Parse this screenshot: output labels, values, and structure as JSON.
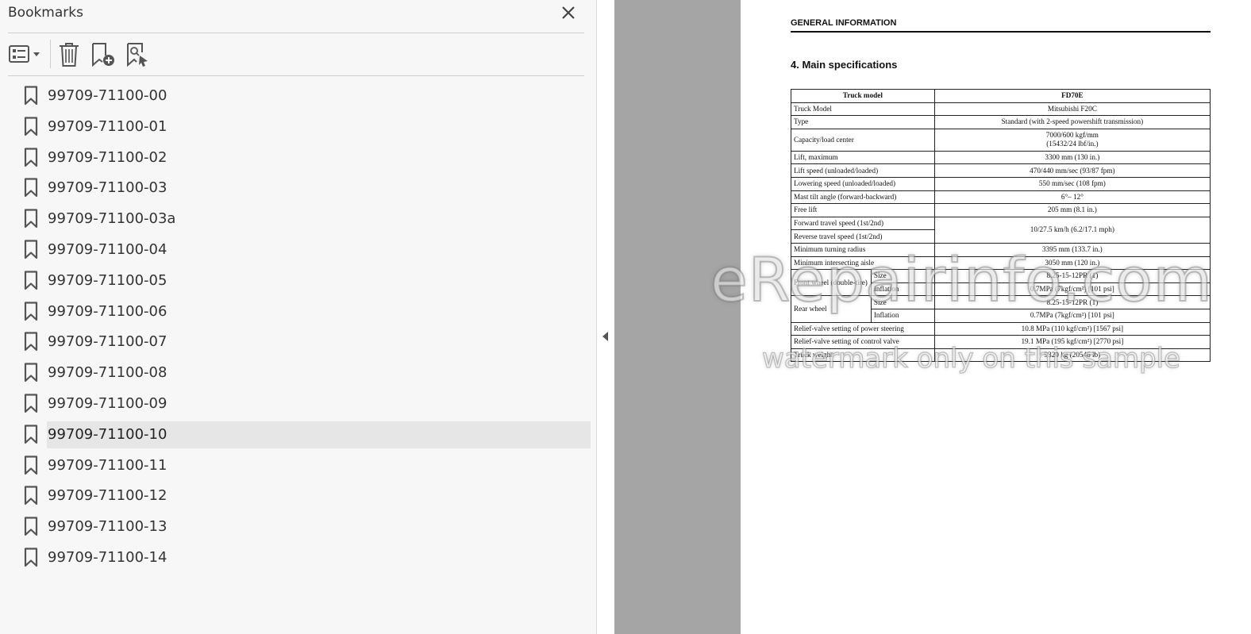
{
  "panel": {
    "title": "Bookmarks",
    "close_icon": "close-icon",
    "toolbar": {
      "options_icon": "options-list-icon",
      "delete_icon": "trash-icon",
      "new_bookmark_icon": "bookmark-add-icon",
      "find_bookmark_icon": "bookmark-search-icon"
    },
    "selected_index": 11,
    "items": [
      {
        "label": "99709-71100-00"
      },
      {
        "label": "99709-71100-01"
      },
      {
        "label": "99709-71100-02"
      },
      {
        "label": "99709-71100-03"
      },
      {
        "label": "99709-71100-03a"
      },
      {
        "label": "99709-71100-04"
      },
      {
        "label": "99709-71100-05"
      },
      {
        "label": "99709-71100-06"
      },
      {
        "label": "99709-71100-07"
      },
      {
        "label": "99709-71100-08"
      },
      {
        "label": "99709-71100-09"
      },
      {
        "label": "99709-71100-10"
      },
      {
        "label": "99709-71100-11"
      },
      {
        "label": "99709-71100-12"
      },
      {
        "label": "99709-71100-13"
      },
      {
        "label": "99709-71100-14"
      }
    ]
  },
  "document": {
    "header": "GENERAL INFORMATION",
    "section": "4. Main specifications",
    "table": {
      "col1": "Truck model",
      "col2": "FD70E",
      "truck_model_label": "Truck Model",
      "truck_model": "Mitsubishi F20C",
      "type_label": "Type",
      "type": "Standard (with 2-speed powershift transmission)",
      "capacity_label": "Capacity/load center",
      "capacity_1": "7000/600 kgf/mm",
      "capacity_2": "(15432/24 lbf/in.)",
      "lift_label": "Lift, maximum",
      "lift": "3300 mm (130 in.)",
      "lift_speed_label": "Lift speed (unloaded/loaded)",
      "lift_speed": "470/440 mm/sec (93/87 fpm)",
      "lowering_label": "Lowering speed (unloaded/loaded)",
      "lowering": "550 mm/sec (108 fpm)",
      "mast_tilt_label": "Mast tilt angle (forward-backward)",
      "mast_tilt": "6°– 12°",
      "free_lift_label": "Free lift",
      "free_lift": "205 mm (8.1 in.)",
      "fwd_speed_label": "Forward travel speed (1st/2nd)",
      "rev_speed_label": "Reverse travel speed (1st/2nd)",
      "travel_speed": "10/27.5 km/h (6.2/17.1 mph)",
      "turning_label": "Minimum turning radius",
      "turning": "3395 mm (133.7 in.)",
      "aisle_label": "Minimum intersecting aisle",
      "aisle": "3050 mm (120 in.)",
      "front_wheel_label": "Front wheel (double-tire)",
      "rear_wheel_label": "Rear wheel",
      "size_label": "Size",
      "inflation_label": "Inflation",
      "front_size": "8.25-15-12PR (1)",
      "front_inflation": "0.7MPa (7kgf/cm²) [101 psi]",
      "rear_size": "8.25-15-12PR (1)",
      "rear_inflation": "0.7MPa (7kgf/cm²) [101 psi]",
      "relief_steer_label": "Relief-valve setting of power steering",
      "relief_steer": "10.8 MPa (110 kgf/cm²) [1567 psi]",
      "relief_ctrl_label": "Relief-valve setting of control valve",
      "relief_ctrl": "19.1 MPa (195 kgf/cm²) [2770 psi]",
      "weight_label": "Truck weight",
      "weight": "9320 kg (20546 lb)"
    },
    "watermark_main": "eRepairinfo.com",
    "watermark_sub": "watermark only on this sample"
  },
  "colors": {
    "panel_bg": "#f7f7f7",
    "selected_bg": "#e6e6e6",
    "gutter_bg": "#a5a5a5",
    "icon": "#555555"
  }
}
